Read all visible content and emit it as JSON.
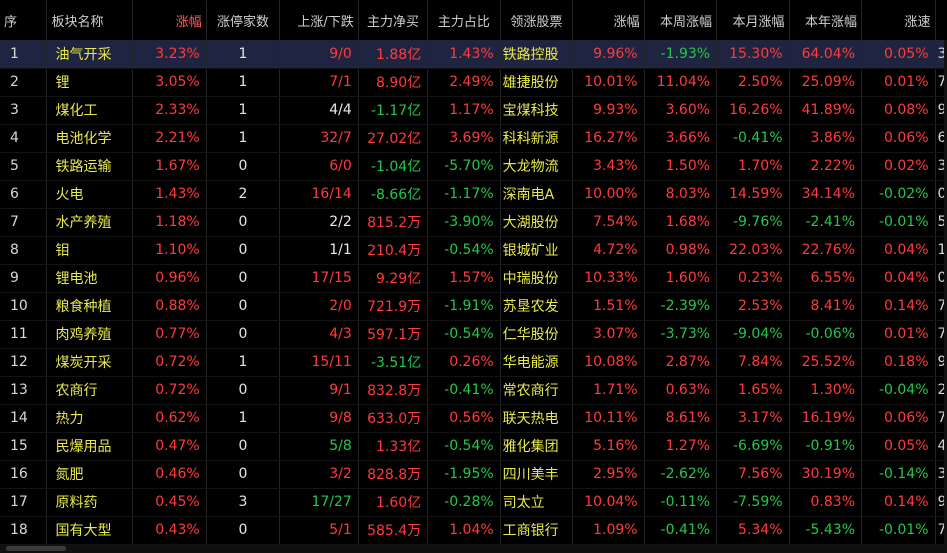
{
  "header": {
    "idx": "序",
    "name": "板块名称",
    "change": "涨幅",
    "limit_up_count": "涨停家数",
    "up_down": "上涨/下跌",
    "main_net_buy": "主力净买",
    "main_ratio": "主力占比",
    "lead_stock": "领涨股票",
    "lead_change": "涨幅",
    "week_change": "本周涨幅",
    "month_change": "本月涨幅",
    "year_change": "本年涨幅",
    "speed": "涨速"
  },
  "rows": [
    {
      "idx": "1",
      "name": "油气开采",
      "change": "3.23%",
      "limit": "1",
      "updown": "9/0",
      "net": "1.88亿",
      "ratio": "1.43%",
      "stock": "铁路控股",
      "lead": "9.96%",
      "week": "-1.93%",
      "month": "15.30%",
      "year": "64.04%",
      "speed": "0.05%",
      "extra": "38"
    },
    {
      "idx": "2",
      "name": "锂",
      "change": "3.05%",
      "limit": "1",
      "updown": "7/1",
      "net": "8.90亿",
      "ratio": "2.49%",
      "stock": "雄捷股份",
      "lead": "10.01%",
      "week": "11.04%",
      "month": "2.50%",
      "year": "25.09%",
      "speed": "0.01%",
      "extra": "7"
    },
    {
      "idx": "3",
      "name": "煤化工",
      "change": "2.33%",
      "limit": "1",
      "updown": "4/4",
      "net": "-1.17亿",
      "ratio": "1.17%",
      "stock": "宝煤科技",
      "lead": "9.93%",
      "week": "3.60%",
      "month": "16.26%",
      "year": "41.89%",
      "speed": "0.08%",
      "extra": "95"
    },
    {
      "idx": "4",
      "name": "电池化学",
      "change": "2.21%",
      "limit": "1",
      "updown": "32/7",
      "net": "27.02亿",
      "ratio": "3.69%",
      "stock": "科科新源",
      "lead": "16.27%",
      "week": "3.66%",
      "month": "-0.41%",
      "year": "3.86%",
      "speed": "0.06%",
      "extra": "69"
    },
    {
      "idx": "5",
      "name": "铁路运输",
      "change": "1.67%",
      "limit": "0",
      "updown": "6/0",
      "net": "-1.04亿",
      "ratio": "-5.70%",
      "stock": "大龙物流",
      "lead": "3.43%",
      "week": "1.50%",
      "month": "1.70%",
      "year": "2.22%",
      "speed": "0.02%",
      "extra": "36"
    },
    {
      "idx": "6",
      "name": "火电",
      "change": "1.43%",
      "limit": "2",
      "updown": "16/14",
      "net": "-8.66亿",
      "ratio": "-1.17%",
      "stock": "深南电A",
      "lead": "10.00%",
      "week": "8.03%",
      "month": "14.59%",
      "year": "34.14%",
      "speed": "-0.02%",
      "extra": "06"
    },
    {
      "idx": "7",
      "name": "水产养殖",
      "change": "1.18%",
      "limit": "0",
      "updown": "2/2",
      "net": "815.2万",
      "ratio": "-3.90%",
      "stock": "大湖股份",
      "lead": "7.54%",
      "week": "1.68%",
      "month": "-9.76%",
      "year": "-2.41%",
      "speed": "-0.01%",
      "extra": "5"
    },
    {
      "idx": "8",
      "name": "钼",
      "change": "1.10%",
      "limit": "0",
      "updown": "1/1",
      "net": "210.4万",
      "ratio": "-0.54%",
      "stock": "银城矿业",
      "lead": "4.72%",
      "week": "0.98%",
      "month": "22.03%",
      "year": "22.76%",
      "speed": "0.04%",
      "extra": "18"
    },
    {
      "idx": "9",
      "name": "锂电池",
      "change": "0.96%",
      "limit": "0",
      "updown": "17/15",
      "net": "9.29亿",
      "ratio": "1.57%",
      "stock": "中瑞股份",
      "lead": "10.33%",
      "week": "1.60%",
      "month": "0.23%",
      "year": "6.55%",
      "speed": "0.04%",
      "extra": "01"
    },
    {
      "idx": "10",
      "name": "粮食种植",
      "change": "0.88%",
      "limit": "0",
      "updown": "2/0",
      "net": "721.9万",
      "ratio": "-1.91%",
      "stock": "苏垦农发",
      "lead": "1.51%",
      "week": "-2.39%",
      "month": "2.53%",
      "year": "8.41%",
      "speed": "0.14%",
      "extra": "7"
    },
    {
      "idx": "11",
      "name": "肉鸡养殖",
      "change": "0.77%",
      "limit": "0",
      "updown": "4/3",
      "net": "597.1万",
      "ratio": "-0.54%",
      "stock": "仁华股份",
      "lead": "3.07%",
      "week": "-3.73%",
      "month": "-9.04%",
      "year": "-0.06%",
      "speed": "0.01%",
      "extra": "7"
    },
    {
      "idx": "12",
      "name": "煤炭开采",
      "change": "0.72%",
      "limit": "1",
      "updown": "15/11",
      "net": "-3.51亿",
      "ratio": "0.26%",
      "stock": "华电能源",
      "lead": "10.08%",
      "week": "2.87%",
      "month": "7.84%",
      "year": "25.52%",
      "speed": "0.18%",
      "extra": "96"
    },
    {
      "idx": "13",
      "name": "农商行",
      "change": "0.72%",
      "limit": "0",
      "updown": "9/1",
      "net": "832.8万",
      "ratio": "-0.41%",
      "stock": "常农商行",
      "lead": "1.71%",
      "week": "0.63%",
      "month": "1.65%",
      "year": "1.30%",
      "speed": "-0.04%",
      "extra": "2"
    },
    {
      "idx": "14",
      "name": "热力",
      "change": "0.62%",
      "limit": "1",
      "updown": "9/8",
      "net": "633.0万",
      "ratio": "0.56%",
      "stock": "联天热电",
      "lead": "10.11%",
      "week": "8.61%",
      "month": "3.17%",
      "year": "16.19%",
      "speed": "0.06%",
      "extra": "78"
    },
    {
      "idx": "15",
      "name": "民爆用品",
      "change": "0.47%",
      "limit": "0",
      "updown": "5/8",
      "net": "1.33亿",
      "ratio": "-0.54%",
      "stock": "雅化集团",
      "lead": "5.16%",
      "week": "1.27%",
      "month": "-6.69%",
      "year": "-0.91%",
      "speed": "0.05%",
      "extra": "44"
    },
    {
      "idx": "16",
      "name": "氮肥",
      "change": "0.46%",
      "limit": "0",
      "updown": "3/2",
      "net": "828.8万",
      "ratio": "-1.95%",
      "stock": "四川美丰",
      "lead": "2.95%",
      "week": "-2.62%",
      "month": "7.56%",
      "year": "30.19%",
      "speed": "-0.14%",
      "extra": "34"
    },
    {
      "idx": "17",
      "name": "原料药",
      "change": "0.45%",
      "limit": "3",
      "updown": "17/27",
      "net": "1.60亿",
      "ratio": "-0.28%",
      "stock": "司太立",
      "lead": "10.04%",
      "week": "-0.11%",
      "month": "-7.59%",
      "year": "0.83%",
      "speed": "0.14%",
      "extra": "97"
    },
    {
      "idx": "18",
      "name": "国有大型",
      "change": "0.43%",
      "limit": "0",
      "updown": "5/1",
      "net": "585.4万",
      "ratio": "1.04%",
      "stock": "工商银行",
      "lead": "1.09%",
      "week": "-0.41%",
      "month": "5.34%",
      "year": "-5.43%",
      "speed": "-0.01%",
      "extra": "7"
    }
  ],
  "colors": {
    "up": "#ff3b3b",
    "down": "#25c748",
    "name": "#e9e94a",
    "selected_row": "#1f2541"
  }
}
